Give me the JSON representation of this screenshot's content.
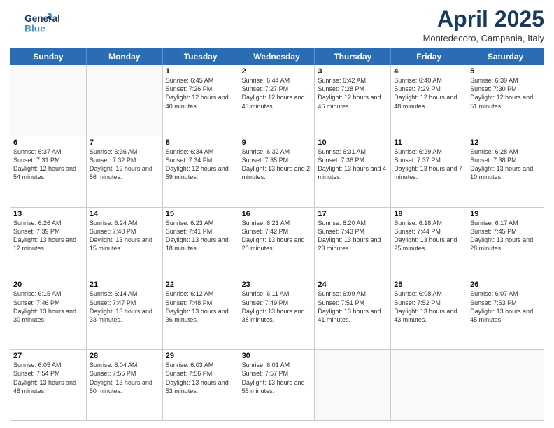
{
  "header": {
    "logo_line1": "General",
    "logo_line2": "Blue",
    "month": "April 2025",
    "location": "Montedecoro, Campania, Italy"
  },
  "days_of_week": [
    "Sunday",
    "Monday",
    "Tuesday",
    "Wednesday",
    "Thursday",
    "Friday",
    "Saturday"
  ],
  "weeks": [
    [
      {
        "day": "",
        "sunrise": "",
        "sunset": "",
        "daylight": ""
      },
      {
        "day": "",
        "sunrise": "",
        "sunset": "",
        "daylight": ""
      },
      {
        "day": "1",
        "sunrise": "Sunrise: 6:45 AM",
        "sunset": "Sunset: 7:26 PM",
        "daylight": "Daylight: 12 hours and 40 minutes."
      },
      {
        "day": "2",
        "sunrise": "Sunrise: 6:44 AM",
        "sunset": "Sunset: 7:27 PM",
        "daylight": "Daylight: 12 hours and 43 minutes."
      },
      {
        "day": "3",
        "sunrise": "Sunrise: 6:42 AM",
        "sunset": "Sunset: 7:28 PM",
        "daylight": "Daylight: 12 hours and 46 minutes."
      },
      {
        "day": "4",
        "sunrise": "Sunrise: 6:40 AM",
        "sunset": "Sunset: 7:29 PM",
        "daylight": "Daylight: 12 hours and 48 minutes."
      },
      {
        "day": "5",
        "sunrise": "Sunrise: 6:39 AM",
        "sunset": "Sunset: 7:30 PM",
        "daylight": "Daylight: 12 hours and 51 minutes."
      }
    ],
    [
      {
        "day": "6",
        "sunrise": "Sunrise: 6:37 AM",
        "sunset": "Sunset: 7:31 PM",
        "daylight": "Daylight: 12 hours and 54 minutes."
      },
      {
        "day": "7",
        "sunrise": "Sunrise: 6:36 AM",
        "sunset": "Sunset: 7:32 PM",
        "daylight": "Daylight: 12 hours and 56 minutes."
      },
      {
        "day": "8",
        "sunrise": "Sunrise: 6:34 AM",
        "sunset": "Sunset: 7:34 PM",
        "daylight": "Daylight: 12 hours and 59 minutes."
      },
      {
        "day": "9",
        "sunrise": "Sunrise: 6:32 AM",
        "sunset": "Sunset: 7:35 PM",
        "daylight": "Daylight: 13 hours and 2 minutes."
      },
      {
        "day": "10",
        "sunrise": "Sunrise: 6:31 AM",
        "sunset": "Sunset: 7:36 PM",
        "daylight": "Daylight: 13 hours and 4 minutes."
      },
      {
        "day": "11",
        "sunrise": "Sunrise: 6:29 AM",
        "sunset": "Sunset: 7:37 PM",
        "daylight": "Daylight: 13 hours and 7 minutes."
      },
      {
        "day": "12",
        "sunrise": "Sunrise: 6:28 AM",
        "sunset": "Sunset: 7:38 PM",
        "daylight": "Daylight: 13 hours and 10 minutes."
      }
    ],
    [
      {
        "day": "13",
        "sunrise": "Sunrise: 6:26 AM",
        "sunset": "Sunset: 7:39 PM",
        "daylight": "Daylight: 13 hours and 12 minutes."
      },
      {
        "day": "14",
        "sunrise": "Sunrise: 6:24 AM",
        "sunset": "Sunset: 7:40 PM",
        "daylight": "Daylight: 13 hours and 15 minutes."
      },
      {
        "day": "15",
        "sunrise": "Sunrise: 6:23 AM",
        "sunset": "Sunset: 7:41 PM",
        "daylight": "Daylight: 13 hours and 18 minutes."
      },
      {
        "day": "16",
        "sunrise": "Sunrise: 6:21 AM",
        "sunset": "Sunset: 7:42 PM",
        "daylight": "Daylight: 13 hours and 20 minutes."
      },
      {
        "day": "17",
        "sunrise": "Sunrise: 6:20 AM",
        "sunset": "Sunset: 7:43 PM",
        "daylight": "Daylight: 13 hours and 23 minutes."
      },
      {
        "day": "18",
        "sunrise": "Sunrise: 6:18 AM",
        "sunset": "Sunset: 7:44 PM",
        "daylight": "Daylight: 13 hours and 25 minutes."
      },
      {
        "day": "19",
        "sunrise": "Sunrise: 6:17 AM",
        "sunset": "Sunset: 7:45 PM",
        "daylight": "Daylight: 13 hours and 28 minutes."
      }
    ],
    [
      {
        "day": "20",
        "sunrise": "Sunrise: 6:15 AM",
        "sunset": "Sunset: 7:46 PM",
        "daylight": "Daylight: 13 hours and 30 minutes."
      },
      {
        "day": "21",
        "sunrise": "Sunrise: 6:14 AM",
        "sunset": "Sunset: 7:47 PM",
        "daylight": "Daylight: 13 hours and 33 minutes."
      },
      {
        "day": "22",
        "sunrise": "Sunrise: 6:12 AM",
        "sunset": "Sunset: 7:48 PM",
        "daylight": "Daylight: 13 hours and 36 minutes."
      },
      {
        "day": "23",
        "sunrise": "Sunrise: 6:11 AM",
        "sunset": "Sunset: 7:49 PM",
        "daylight": "Daylight: 13 hours and 38 minutes."
      },
      {
        "day": "24",
        "sunrise": "Sunrise: 6:09 AM",
        "sunset": "Sunset: 7:51 PM",
        "daylight": "Daylight: 13 hours and 41 minutes."
      },
      {
        "day": "25",
        "sunrise": "Sunrise: 6:08 AM",
        "sunset": "Sunset: 7:52 PM",
        "daylight": "Daylight: 13 hours and 43 minutes."
      },
      {
        "day": "26",
        "sunrise": "Sunrise: 6:07 AM",
        "sunset": "Sunset: 7:53 PM",
        "daylight": "Daylight: 13 hours and 45 minutes."
      }
    ],
    [
      {
        "day": "27",
        "sunrise": "Sunrise: 6:05 AM",
        "sunset": "Sunset: 7:54 PM",
        "daylight": "Daylight: 13 hours and 48 minutes."
      },
      {
        "day": "28",
        "sunrise": "Sunrise: 6:04 AM",
        "sunset": "Sunset: 7:55 PM",
        "daylight": "Daylight: 13 hours and 50 minutes."
      },
      {
        "day": "29",
        "sunrise": "Sunrise: 6:03 AM",
        "sunset": "Sunset: 7:56 PM",
        "daylight": "Daylight: 13 hours and 53 minutes."
      },
      {
        "day": "30",
        "sunrise": "Sunrise: 6:01 AM",
        "sunset": "Sunset: 7:57 PM",
        "daylight": "Daylight: 13 hours and 55 minutes."
      },
      {
        "day": "",
        "sunrise": "",
        "sunset": "",
        "daylight": ""
      },
      {
        "day": "",
        "sunrise": "",
        "sunset": "",
        "daylight": ""
      },
      {
        "day": "",
        "sunrise": "",
        "sunset": "",
        "daylight": ""
      }
    ]
  ]
}
